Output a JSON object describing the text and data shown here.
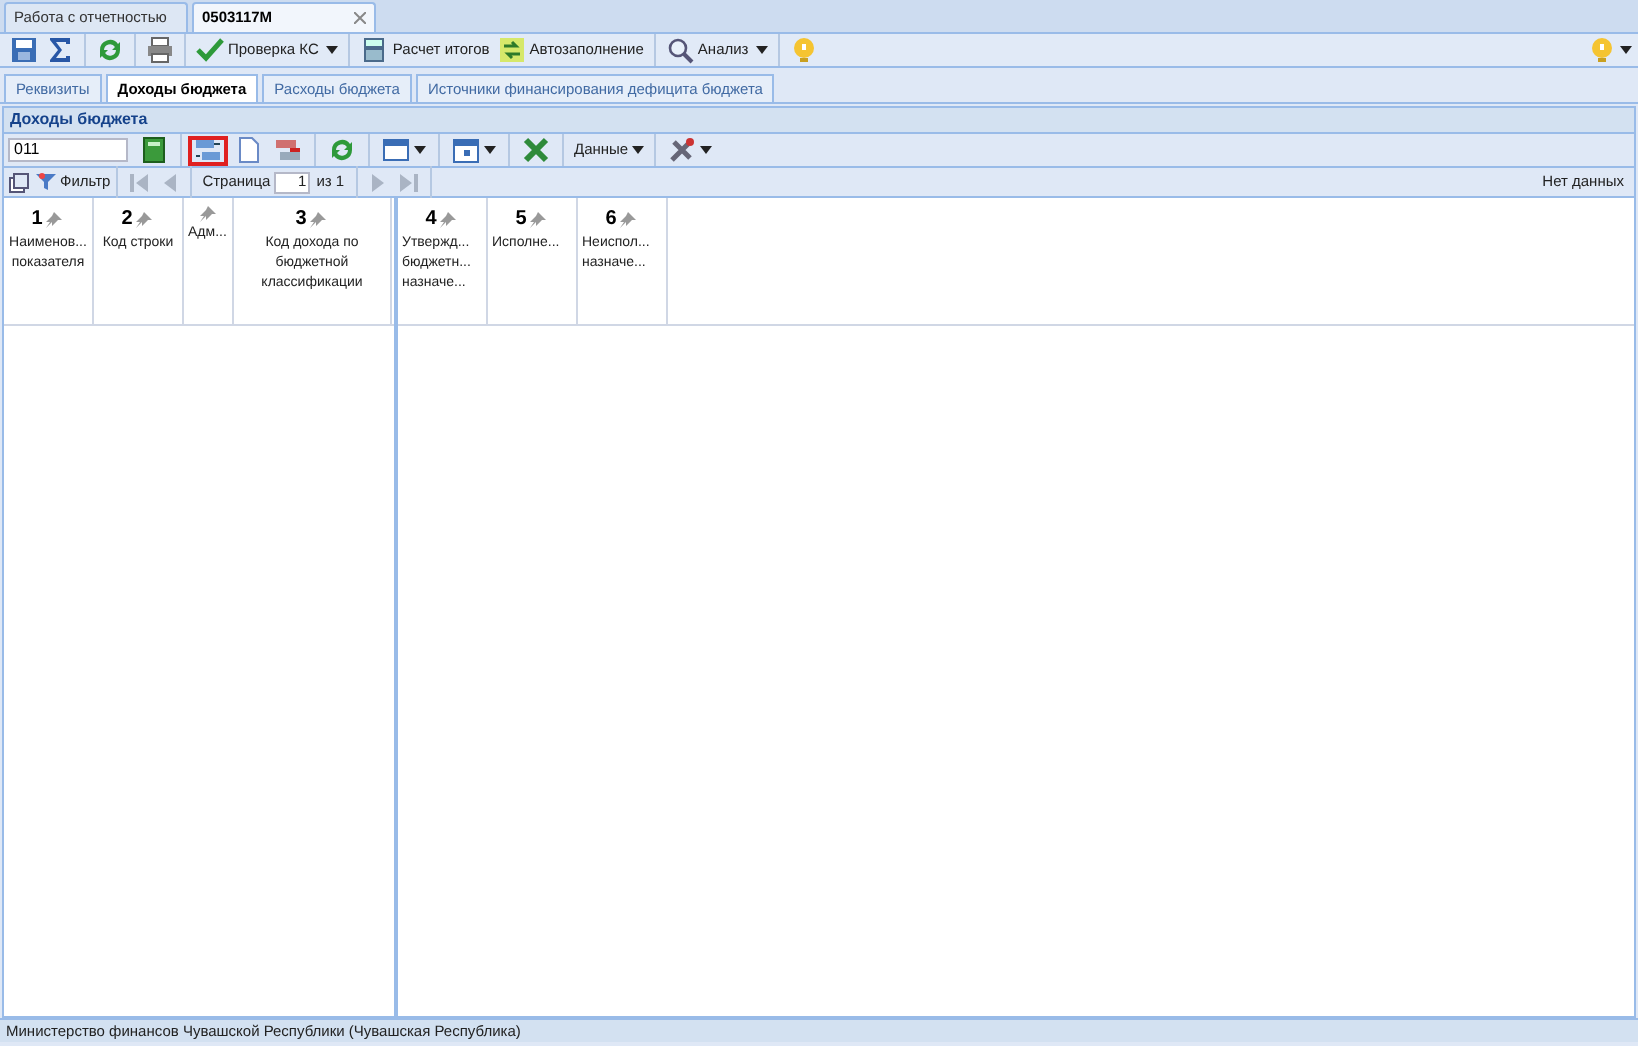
{
  "doc_tabs": [
    {
      "label": "Работа с отчетностью",
      "selected": false
    },
    {
      "label": "0503117М",
      "selected": true
    }
  ],
  "main_toolbar": [
    {
      "kind": "icon"
    },
    {
      "kind": "icon"
    },
    {
      "kind": "sep"
    },
    {
      "kind": "icon"
    },
    {
      "kind": "sep"
    },
    {
      "kind": "icon"
    },
    {
      "kind": "sep"
    },
    {
      "kind": "button",
      "label": "Проверка КС",
      "menu": true
    },
    {
      "kind": "sep"
    },
    {
      "kind": "button",
      "label": "Расчет итогов",
      "menu": false
    },
    {
      "kind": "button",
      "label": "Автозаполнение",
      "menu": false
    },
    {
      "kind": "sep"
    },
    {
      "kind": "button",
      "label": "Анализ",
      "menu": true
    },
    {
      "kind": "sep"
    },
    {
      "kind": "icon"
    }
  ],
  "section_tabs": [
    {
      "label": "Реквизиты",
      "selected": false
    },
    {
      "label": "Доходы бюджета",
      "selected": true
    },
    {
      "label": "Расходы бюджета",
      "selected": false
    },
    {
      "label": "Источники финансирования дефицита бюджета",
      "selected": false
    }
  ],
  "panel_title": "Доходы бюджета",
  "grid_toolbar": {
    "value": "011",
    "items": [
      {
        "kind": "icon",
        "highlighted": false,
        "menu": false
      },
      {
        "kind": "sep"
      },
      {
        "kind": "icon",
        "highlighted": true,
        "menu": false
      },
      {
        "kind": "icon",
        "highlighted": false,
        "menu": false
      },
      {
        "kind": "icon",
        "highlighted": false,
        "menu": false
      },
      {
        "kind": "sep"
      },
      {
        "kind": "icon",
        "highlighted": false,
        "menu": false
      },
      {
        "kind": "sep"
      },
      {
        "kind": "icon",
        "highlighted": false,
        "menu": true
      },
      {
        "kind": "sep"
      },
      {
        "kind": "icon",
        "highlighted": false,
        "menu": true
      },
      {
        "kind": "sep"
      },
      {
        "kind": "icon",
        "highlighted": false,
        "menu": false
      },
      {
        "kind": "sep"
      },
      {
        "kind": "button",
        "label": "Данные",
        "menu": true
      },
      {
        "kind": "sep"
      },
      {
        "kind": "icon",
        "highlighted": false,
        "menu": true
      }
    ]
  },
  "pager": {
    "filter": "Фильтр",
    "page_label": "Страница",
    "page": "1",
    "of": "из 1",
    "status": "Нет данных"
  },
  "locked_columns": [
    {
      "number": "1",
      "label": "Наименов... показателя"
    },
    {
      "number": "2",
      "label": "Код строки"
    },
    {
      "label": "Адм..."
    },
    {
      "number": "3",
      "label": "Код дохода по бюджетной классификации"
    }
  ],
  "columns": [
    {
      "number": "4",
      "label": "Утвержд... бюджетн... назначе..."
    },
    {
      "number": "5",
      "label": "Исполне..."
    },
    {
      "number": "6",
      "label": "Неиспол... назначе..."
    }
  ],
  "status_bar": "Министерство финансов Чувашской Республики (Чувашская Республика)"
}
